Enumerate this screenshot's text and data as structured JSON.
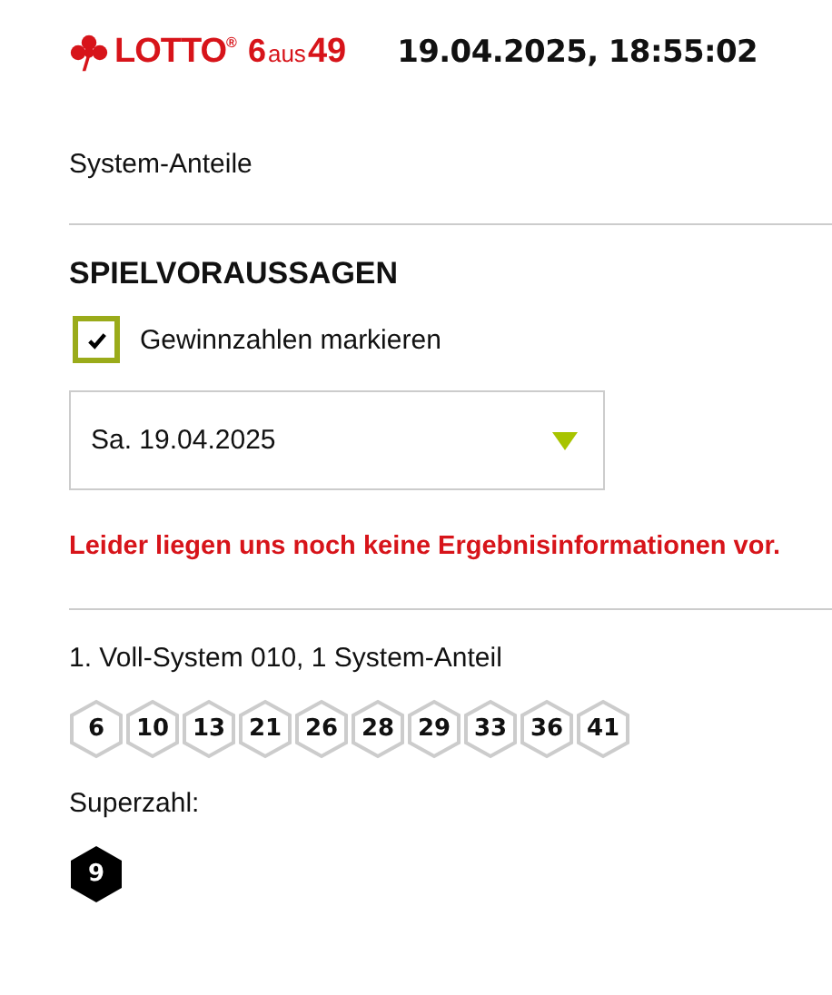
{
  "header": {
    "logo": {
      "brand": "LOTTO",
      "registered": "®",
      "game_a": "6",
      "game_b": "aus",
      "game_c": "49"
    },
    "datetime": "19.04.2025, 18:55:02"
  },
  "section_label": "System-Anteile",
  "predictions": {
    "title": "SPIELVORAUSSAGEN",
    "checkbox": {
      "label": "Gewinnzahlen markieren",
      "checked": true
    },
    "date_select": {
      "value": "Sa. 19.04.2025"
    },
    "error": "Leider liegen uns noch keine Ergebnisinformationen vor."
  },
  "system": {
    "title": "1. Voll-System 010, 1 System-Anteil",
    "numbers": [
      "6",
      "10",
      "13",
      "21",
      "26",
      "28",
      "29",
      "33",
      "36",
      "41"
    ],
    "superzahl_label": "Superzahl:",
    "superzahl": "9"
  }
}
